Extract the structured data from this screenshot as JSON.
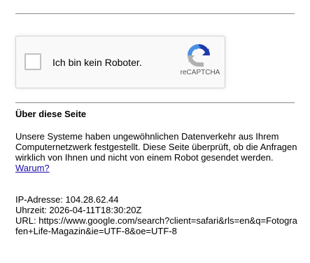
{
  "captcha": {
    "checkbox_label": "Ich bin kein Roboter.",
    "brand": "reCAPTCHA",
    "logo_icon": "recaptcha-logo-icon",
    "colors": {
      "blue": "#1c3aa9",
      "light_blue": "#4a90e2",
      "gray": "#b1b1b1"
    }
  },
  "about": {
    "title": "Über diese Seite",
    "text": "Unsere Systeme haben ungewöhnlichen Datenverkehr aus Ihrem Computernetzwerk festgestellt. Diese Seite überprüft, ob die Anfragen wirklich von Ihnen und nicht von einem Robot gesendet werden.",
    "link_label": "Warum?"
  },
  "info": {
    "ip_line": "IP-Adresse: 104.28.62.44",
    "time_line": "Uhrzeit: 2026-04-11T18:30:20Z",
    "url_line": "URL: https://www.google.com/search?client=safari&rls=en&q=Fotografen+Life-Magazin&ie=UTF-8&oe=UTF-8"
  },
  "colors": {
    "link": "#1a0dab",
    "divider": "#8a8a8a"
  }
}
